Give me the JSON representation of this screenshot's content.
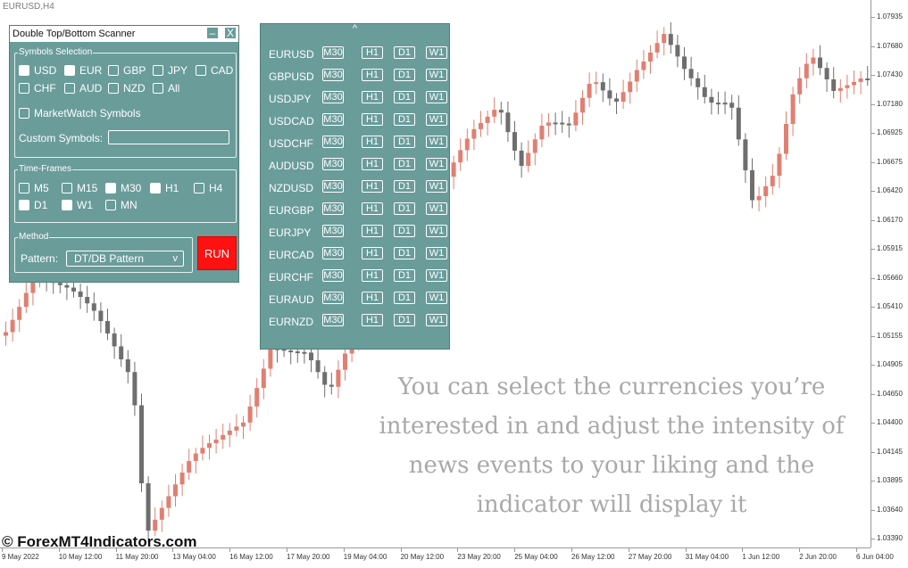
{
  "chart": {
    "symbol_title": "EURUSD,H4",
    "up_color": "#e07f72",
    "down_color": "#6e6e6e",
    "price_labels": [
      "1.07935",
      "1.07680",
      "1.07430",
      "1.07180",
      "1.06925",
      "1.06675",
      "1.06420",
      "1.06170",
      "1.05915",
      "1.05660",
      "1.05410",
      "1.05155",
      "1.04905",
      "1.04650",
      "1.04400",
      "1.04145",
      "1.03895",
      "1.03640",
      "1.03390"
    ],
    "time_labels": [
      "9 May 2022",
      "10 May 12:00",
      "11 May 20:00",
      "13 May 04:00",
      "16 May 12:00",
      "17 May 20:00",
      "19 May 04:00",
      "20 May 12:00",
      "23 May 20:00",
      "25 May 04:00",
      "26 May 12:00",
      "27 May 20:00",
      "31 May 04:00",
      "1 Jun 12:00",
      "2 Jun 20:00",
      "6 Jun 04:00"
    ]
  },
  "scanner": {
    "title": "Double Top/Bottom Scanner",
    "minimize_label": "–",
    "close_label": "X",
    "symbols_group_label": "Symbols Selection",
    "currencies": [
      {
        "label": "USD",
        "checked": true
      },
      {
        "label": "EUR",
        "checked": true
      },
      {
        "label": "GBP",
        "checked": false
      },
      {
        "label": "JPY",
        "checked": false
      },
      {
        "label": "CAD",
        "checked": false
      },
      {
        "label": "CHF",
        "checked": false
      },
      {
        "label": "AUD",
        "checked": false
      },
      {
        "label": "NZD",
        "checked": false
      },
      {
        "label": "All",
        "checked": false
      }
    ],
    "marketwatch_label": "MarketWatch Symbols",
    "marketwatch_checked": false,
    "custom_symbols_label": "Custom Symbols:",
    "custom_symbols_value": "",
    "timeframes_group_label": "Time-Frames",
    "timeframes": [
      {
        "label": "M5",
        "checked": false
      },
      {
        "label": "M15",
        "checked": false
      },
      {
        "label": "M30",
        "checked": true
      },
      {
        "label": "H1",
        "checked": true
      },
      {
        "label": "H4",
        "checked": false
      },
      {
        "label": "D1",
        "checked": true
      },
      {
        "label": "W1",
        "checked": true
      },
      {
        "label": "MN",
        "checked": false
      }
    ],
    "method_group_label": "Method",
    "pattern_label": "Pattern:",
    "pattern_value": "DT/DB Pattern",
    "pattern_chevron": "v",
    "run_label": "RUN"
  },
  "results": {
    "collapse_glyph": "^",
    "timeframe_buttons": [
      "M30",
      "H1",
      "D1",
      "W1"
    ],
    "symbols": [
      "EURUSD",
      "GBPUSD",
      "USDJPY",
      "USDCAD",
      "USDCHF",
      "AUDUSD",
      "NZDUSD",
      "EURGBP",
      "EURJPY",
      "EURCAD",
      "EURCHF",
      "EURAUD",
      "EURNZD"
    ]
  },
  "caption": "You can select the currencies you’re interested in and adjust the intensity of news events to your liking and the indicator will display it",
  "watermark": "© ForexMT4Indicators.com"
}
